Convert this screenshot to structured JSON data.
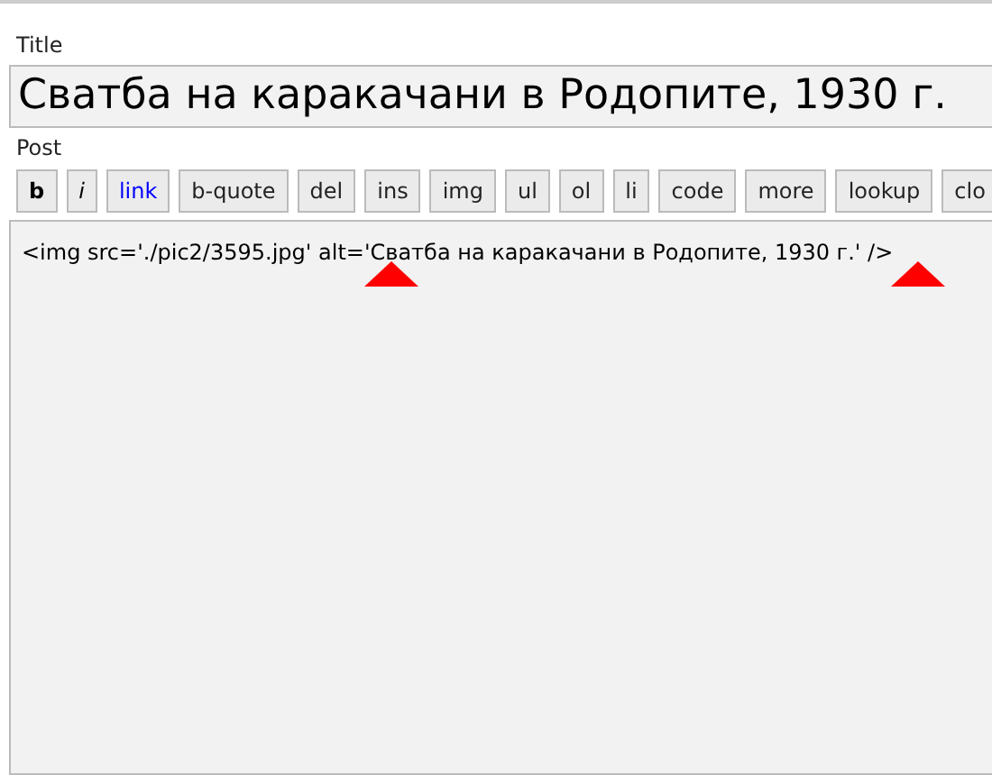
{
  "title_label": "Title",
  "title_value": "Сватба на каракачани в Родопите, 1930 г.",
  "post_label": "Post",
  "toolbar": [
    {
      "label": "b",
      "kind": "bold"
    },
    {
      "label": "i",
      "kind": "italic"
    },
    {
      "label": "link",
      "kind": "link"
    },
    {
      "label": "b-quote",
      "kind": "plain"
    },
    {
      "label": "del",
      "kind": "plain"
    },
    {
      "label": "ins",
      "kind": "plain"
    },
    {
      "label": "img",
      "kind": "plain"
    },
    {
      "label": "ul",
      "kind": "plain"
    },
    {
      "label": "ol",
      "kind": "plain"
    },
    {
      "label": "li",
      "kind": "plain"
    },
    {
      "label": "code",
      "kind": "plain"
    },
    {
      "label": "more",
      "kind": "plain"
    },
    {
      "label": "lookup",
      "kind": "plain"
    },
    {
      "label": "clo",
      "kind": "plain"
    }
  ],
  "post_body": "<img src='./pic2/3595.jpg' alt='Сватба на каракачани в Родопите, 1930 г.' />"
}
